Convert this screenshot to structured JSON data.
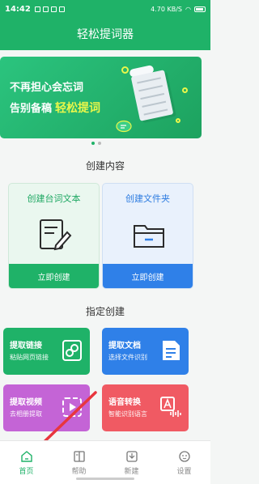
{
  "status_bar": {
    "time": "14:42",
    "speed": "4.70 KB/S"
  },
  "header": {
    "title": "轻松提词器"
  },
  "banner": {
    "line1": "不再担心会忘词",
    "line2": "告别备稿",
    "highlight": "轻松提词"
  },
  "carousel": {
    "total": 2,
    "active": 0
  },
  "sections": {
    "create": "创建内容",
    "specified": "指定创建"
  },
  "big_cards": [
    {
      "title": "创建台词文本",
      "action": "立即创建",
      "icon": "document-edit-icon"
    },
    {
      "title": "创建文件夹",
      "action": "立即创建",
      "icon": "folder-icon"
    }
  ],
  "small_cards": [
    {
      "title": "提取链接",
      "subtitle": "粘贴网页链接",
      "icon": "link-icon"
    },
    {
      "title": "提取文档",
      "subtitle": "选择文件识别",
      "icon": "document-icon"
    },
    {
      "title": "提取视频",
      "subtitle": "去相册提取",
      "icon": "video-icon"
    },
    {
      "title": "语音转换",
      "subtitle": "智能识别语言",
      "icon": "voice-icon"
    }
  ],
  "nav": [
    {
      "label": "首页",
      "icon": "home-icon",
      "active": true
    },
    {
      "label": "帮助",
      "icon": "book-icon",
      "active": false
    },
    {
      "label": "新建",
      "icon": "new-icon",
      "active": false
    },
    {
      "label": "设置",
      "icon": "settings-icon",
      "active": false
    }
  ],
  "colors": {
    "primary": "#1fb268",
    "blue": "#2f80e8",
    "purple": "#c464d6",
    "red": "#f05a63",
    "highlight": "#e9f74a",
    "arrow": "#e8363e"
  }
}
